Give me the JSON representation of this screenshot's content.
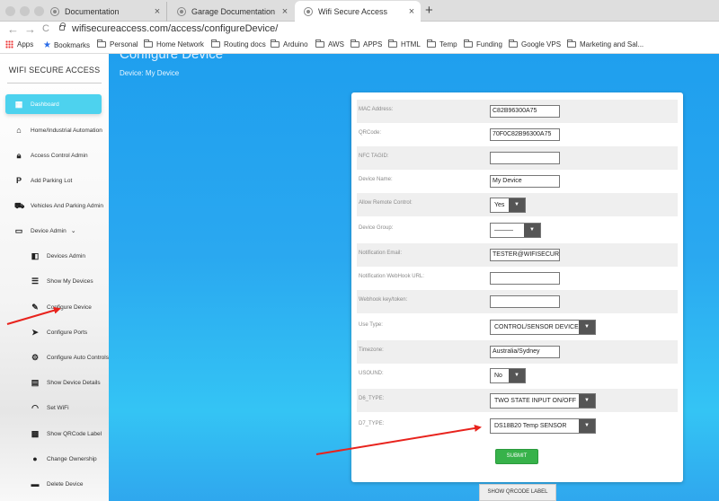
{
  "browser": {
    "tabs": [
      {
        "title": "Documentation",
        "close": "×"
      },
      {
        "title": "Garage Documentation",
        "close": "×"
      },
      {
        "title": "Wifi Secure Access",
        "close": "×"
      }
    ],
    "new_tab": "+",
    "nav": {
      "back": "←",
      "forward": "→",
      "reload": "C"
    },
    "url": "wifisecureaccess.com/access/configureDevice/",
    "bookmarks": [
      "Apps",
      "Bookmarks",
      "Personal",
      "Home Network",
      "Routing docs",
      "Arduino",
      "AWS",
      "APPS",
      "HTML",
      "Temp",
      "Funding",
      "Google VPS",
      "Marketing and Sal..."
    ]
  },
  "sidebar": {
    "brand": "WIFI SECURE ACCESS",
    "items": [
      {
        "label": "Dashboard",
        "icon": "dashboard-icon"
      },
      {
        "label": "Home/Industrial Automation",
        "icon": "factory-icon"
      },
      {
        "label": "Access Control Admin",
        "icon": "lock-icon"
      },
      {
        "label": "Add Parking Lot",
        "icon": "parking-icon"
      },
      {
        "label": "Vehicles And Parking Admin",
        "icon": "truck-icon"
      },
      {
        "label": "Device Admin",
        "icon": "monitor-icon",
        "caret": "⌄"
      },
      {
        "label": "Devices Admin",
        "icon": "devices-icon"
      },
      {
        "label": "Show My Devices",
        "icon": "list-icon"
      },
      {
        "label": "Configure Device",
        "icon": "wrench-icon"
      },
      {
        "label": "Configure Ports",
        "icon": "label-icon"
      },
      {
        "label": "Configure Auto Controls",
        "icon": "gear-icon"
      },
      {
        "label": "Show Device Details",
        "icon": "grid-icon"
      },
      {
        "label": "Set WiFi",
        "icon": "wifi-icon"
      },
      {
        "label": "Show QRCode Label",
        "icon": "qrcode-icon"
      },
      {
        "label": "Change Ownership",
        "icon": "people-icon"
      },
      {
        "label": "Delete Device",
        "icon": "trash-icon"
      }
    ]
  },
  "main": {
    "title": "Configure Device",
    "subtitle": "Device: My Device",
    "form": {
      "mac_label": "MAC Address:",
      "mac_value": "C82B96300A75",
      "qr_label": "QRCode:",
      "qr_value": "70F0C82B96300A75",
      "nfc_label": "NFC TAGID:",
      "nfc_value": "",
      "name_label": "Device Name:",
      "name_value": "My Device",
      "remote_label": "Allow Remote Control:",
      "remote_value": "Yes",
      "group_label": "Device Group:",
      "group_value": "———",
      "email_label": "Notification Email:",
      "email_value": "TESTER@WIFISECURE",
      "webhook_label": "Notification WebHook URL:",
      "webhook_value": "",
      "webhook_key_label": "Webhook key/token:",
      "webhook_key_value": "",
      "use_type_label": "Use Type:",
      "use_type_value": "CONTROL/SENSOR DEVICE",
      "timezone_label": "Timezone:",
      "timezone_value": "Australia/Sydney",
      "usound_label": "USOUND:",
      "usound_value": "No",
      "d6_label": "D6_TYPE:",
      "d6_value": "TWO STATE INPUT ON/OFF",
      "d7_label": "D7_TYPE:",
      "d7_value": "DS18B20 Temp SENSOR",
      "dropdown_glyph": "▼",
      "submit_label": "SUBMIT"
    },
    "qr_button_label": "SHOW QRCODE LABEL"
  },
  "colors": {
    "accent": "#4dd2ee",
    "background": "#2aa8f0",
    "submit": "#37b24a",
    "annotation_arrow": "#e8231d"
  }
}
